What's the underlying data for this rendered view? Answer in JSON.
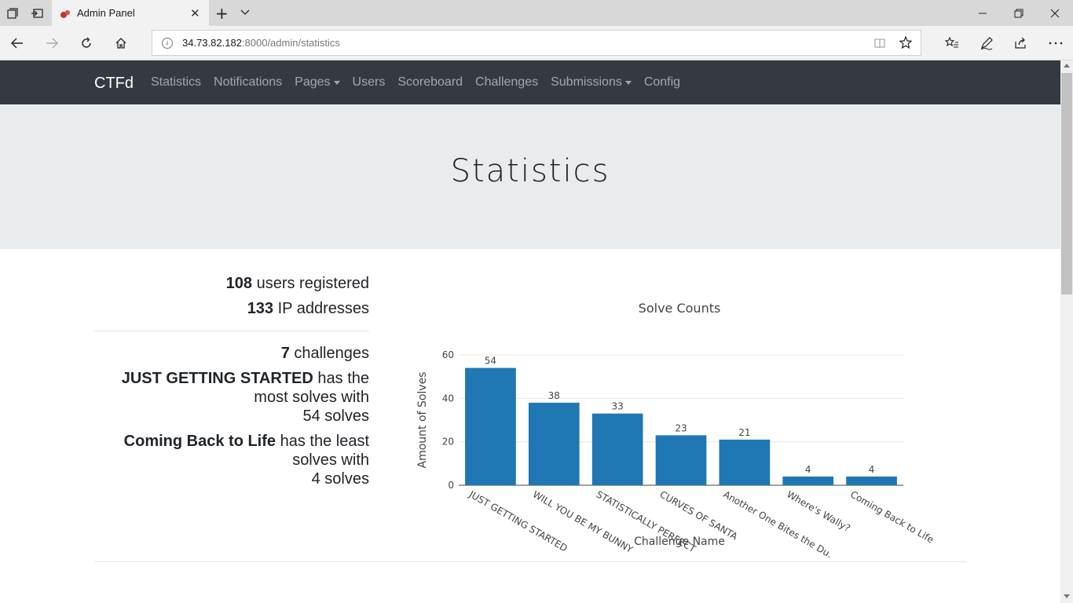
{
  "browser": {
    "tab_title": "Admin Panel",
    "url_host": "34.73.82.182",
    "url_path": ":8000/admin/statistics",
    "icons": [
      "tab-manager-icon",
      "set-aside-tabs-icon",
      "close-icon",
      "new-tab-icon",
      "tab-list-icon",
      "minimize-icon",
      "restore-icon",
      "back-icon",
      "forward-icon",
      "refresh-icon",
      "home-icon",
      "info-icon",
      "reading-view-icon",
      "favorite-star-icon",
      "favorites-list-icon",
      "pen-icon",
      "share-icon",
      "more-icon"
    ]
  },
  "navbar": {
    "brand": "CTFd",
    "items": [
      {
        "label": "Statistics",
        "dropdown": false
      },
      {
        "label": "Notifications",
        "dropdown": false
      },
      {
        "label": "Pages",
        "dropdown": true
      },
      {
        "label": "Users",
        "dropdown": false
      },
      {
        "label": "Scoreboard",
        "dropdown": false
      },
      {
        "label": "Challenges",
        "dropdown": false
      },
      {
        "label": "Submissions",
        "dropdown": true
      },
      {
        "label": "Config",
        "dropdown": false
      }
    ]
  },
  "page_title": "Statistics",
  "stats": {
    "users_count": "108",
    "users_label": " users registered",
    "ip_count": "133",
    "ip_label": " IP addresses",
    "challenges_count": "7",
    "challenges_label": " challenges",
    "most_name": "JUST GETTING STARTED",
    "most_text_1": " has the most solves with",
    "most_text_2": "54 solves",
    "least_name": "Coming Back to Life",
    "least_text_1": " has the least solves with",
    "least_text_2": "4 solves"
  },
  "chart_data": {
    "type": "bar",
    "title": "Solve Counts",
    "xlabel": "Challenge Name",
    "ylabel": "Amount of Solves",
    "categories": [
      "JUST GETTING STARTED",
      "WILL YOU BE MY BUNNY",
      "STATISTICALLY PERFECT",
      "CURVES OF SANTA",
      "Another One Bites the Dust",
      "Where's Wally?",
      "Coming Back to Life"
    ],
    "tick_labels": [
      "JUST GETTING STARTED",
      "WILL YOU BE MY BUNNY",
      "STATISTICALLY PERFECT",
      "CURVES OF SANTA",
      "Another One Bites the Du...",
      "Where's Wally?",
      "Coming Back to Life"
    ],
    "values": [
      54,
      38,
      33,
      23,
      21,
      4,
      4
    ],
    "yticks": [
      0,
      20,
      40,
      60
    ],
    "ylim": [
      0,
      60
    ],
    "grid": true,
    "color": "#1f77b4"
  }
}
